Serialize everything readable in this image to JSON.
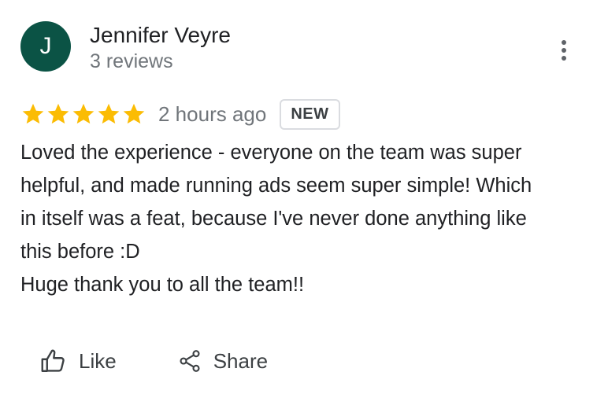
{
  "author": {
    "initial": "J",
    "name": "Jennifer Veyre",
    "review_count": "3 reviews",
    "avatar_color": "#0b5345"
  },
  "menu": {
    "icon": "more-vertical-icon"
  },
  "review": {
    "rating": 5,
    "max_rating": 5,
    "star_color": "#fbbc04",
    "time_ago": "2 hours ago",
    "badge": "NEW",
    "lines": [
      "Loved the experience - everyone on the team was super",
      "helpful, and made running ads seem super simple! Which",
      "in itself was a feat, because I've never done anything like",
      "this before :D",
      "Huge thank you to all the team!!"
    ]
  },
  "actions": {
    "like_label": "Like",
    "like_icon": "thumb-up-icon",
    "share_label": "Share",
    "share_icon": "share-icon"
  }
}
